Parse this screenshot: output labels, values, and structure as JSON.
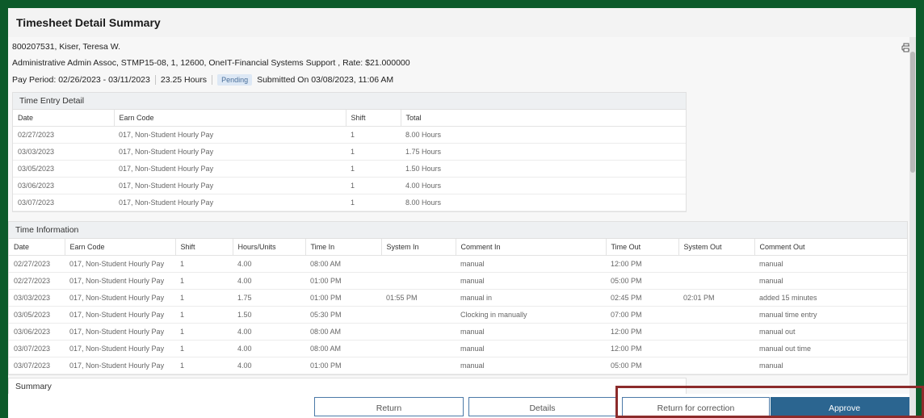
{
  "page": {
    "title": "Timesheet Detail Summary"
  },
  "employee": {
    "line": "800207531, Kiser, Teresa W.",
    "position": "Administrative Admin Assoc, STMP15-08, 1, 12600, OneIT-Financial Systems Support , Rate: $21.000000"
  },
  "pay_period": {
    "period": "Pay Period: 02/26/2023 - 03/11/2023",
    "hours": "23.25 Hours",
    "status": "Pending",
    "submitted": "Submitted On 03/08/2023, 11:06 AM"
  },
  "time_entry": {
    "title": "Time Entry Detail",
    "columns": [
      "Date",
      "Earn Code",
      "Shift",
      "Total"
    ],
    "rows": [
      [
        "02/27/2023",
        "017, Non-Student Hourly Pay",
        "1",
        "8.00 Hours"
      ],
      [
        "03/03/2023",
        "017, Non-Student Hourly Pay",
        "1",
        "1.75 Hours"
      ],
      [
        "03/05/2023",
        "017, Non-Student Hourly Pay",
        "1",
        "1.50 Hours"
      ],
      [
        "03/06/2023",
        "017, Non-Student Hourly Pay",
        "1",
        "4.00 Hours"
      ],
      [
        "03/07/2023",
        "017, Non-Student Hourly Pay",
        "1",
        "8.00 Hours"
      ]
    ]
  },
  "time_info": {
    "title": "Time Information",
    "columns": [
      "Date",
      "Earn Code",
      "Shift",
      "Hours/Units",
      "Time In",
      "System In",
      "Comment In",
      "Time Out",
      "System Out",
      "Comment Out"
    ],
    "rows": [
      [
        "02/27/2023",
        "017, Non-Student Hourly Pay",
        "1",
        "4.00",
        "08:00 AM",
        "",
        "manual",
        "12:00 PM",
        "",
        "manual"
      ],
      [
        "02/27/2023",
        "017, Non-Student Hourly Pay",
        "1",
        "4.00",
        "01:00 PM",
        "",
        "manual",
        "05:00 PM",
        "",
        "manual"
      ],
      [
        "03/03/2023",
        "017, Non-Student Hourly Pay",
        "1",
        "1.75",
        "01:00 PM",
        "01:55 PM",
        "manual in",
        "02:45 PM",
        "02:01 PM",
        "added 15 minutes"
      ],
      [
        "03/05/2023",
        "017, Non-Student Hourly Pay",
        "1",
        "1.50",
        "05:30 PM",
        "",
        "Clocking in manually",
        "07:00 PM",
        "",
        "manual time entry"
      ],
      [
        "03/06/2023",
        "017, Non-Student Hourly Pay",
        "1",
        "4.00",
        "08:00 AM",
        "",
        "manual",
        "12:00 PM",
        "",
        "manual out"
      ],
      [
        "03/07/2023",
        "017, Non-Student Hourly Pay",
        "1",
        "4.00",
        "08:00 AM",
        "",
        "manual",
        "12:00 PM",
        "",
        "manual out time"
      ],
      [
        "03/07/2023",
        "017, Non-Student Hourly Pay",
        "1",
        "4.00",
        "01:00 PM",
        "",
        "manual",
        "05:00 PM",
        "",
        "manual"
      ]
    ]
  },
  "summary": {
    "title": "Summary"
  },
  "buttons": {
    "return": "Return",
    "details": "Details",
    "return_correction": "Return for correction",
    "approve": "Approve"
  },
  "icons": {
    "print": "printer-icon"
  },
  "colors": {
    "frame": "#0c5a2a",
    "primary": "#2b6590",
    "badge_bg": "#dde8f5",
    "highlight": "#8c2b2b"
  }
}
